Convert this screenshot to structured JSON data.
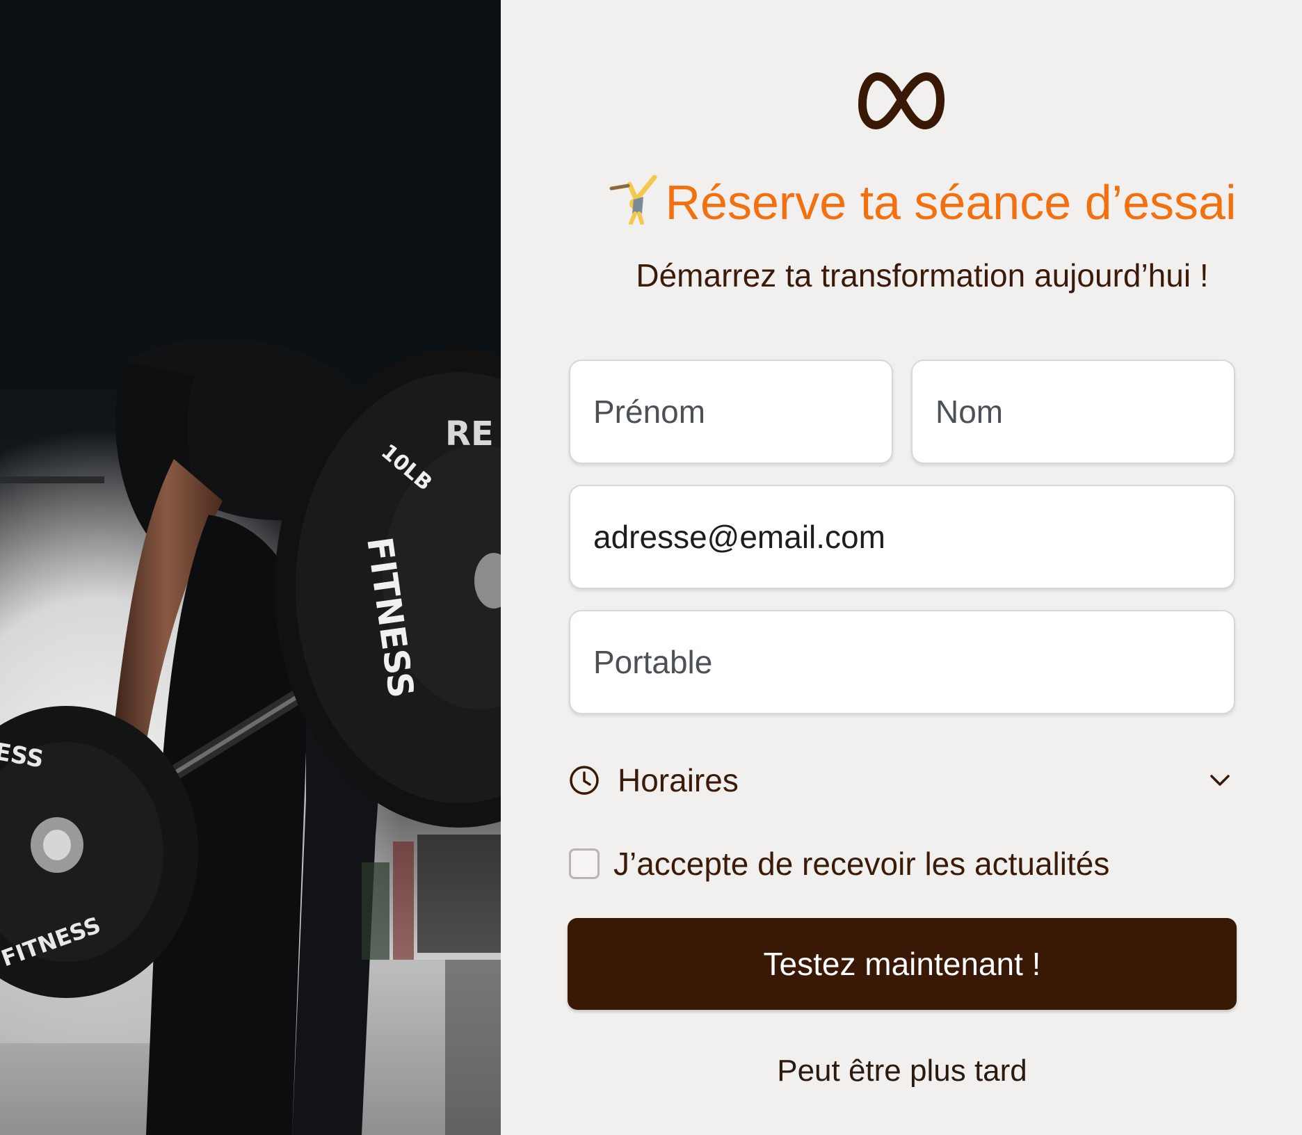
{
  "header": {
    "logo_icon": "infinity-logo-icon",
    "title_emoji_icon": "person-cartwheel-icon",
    "title": "Réserve ta séance d’essai",
    "subtitle": "Démarrez ta transformation aujourd’hui !"
  },
  "hero_image": {
    "plate_text_large": "FITNESS",
    "plate_weight_large": "10LB",
    "plate_brand_fragment": "RE",
    "plate_text_small": "FITNESS",
    "plate_text_small_top": "ESS"
  },
  "form": {
    "first_name_placeholder": "Prénom",
    "last_name_placeholder": "Nom",
    "email_value": "adresse@email.com",
    "phone_placeholder": "Portable",
    "schedule_label": "Horaires",
    "schedule_icon": "clock-icon",
    "schedule_chevron_icon": "chevron-down-icon",
    "consent_label": "J’accepte de recevoir les actualités",
    "consent_checked": false,
    "submit_label": "Testez maintenant !",
    "later_label": "Peut être plus tard"
  },
  "colors": {
    "accent": "#f2700f",
    "brand_dark": "#3a1806",
    "background": "#f1f0ee"
  }
}
